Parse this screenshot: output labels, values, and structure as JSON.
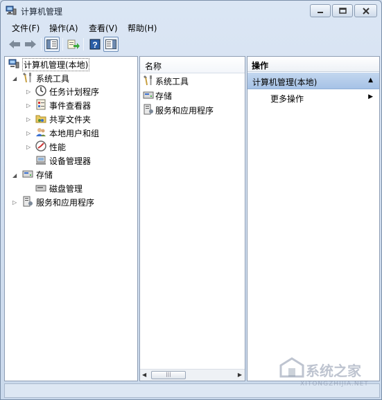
{
  "window": {
    "title": "计算机管理",
    "title_icon": "computer-management-icon"
  },
  "menu": [
    "文件(F)",
    "操作(A)",
    "查看(V)",
    "帮助(H)"
  ],
  "toolbar": {
    "buttons": [
      "back-arrow-icon",
      "forward-arrow-icon",
      "show-hide-console-tree-icon",
      "export-list-icon",
      "help-icon",
      "show-hide-action-pane-icon"
    ]
  },
  "tree": {
    "root": "计算机管理(本地)",
    "system_tools": "系统工具",
    "task_scheduler": "任务计划程序",
    "event_viewer": "事件查看器",
    "shared_folders": "共享文件夹",
    "local_users": "本地用户和组",
    "performance": "性能",
    "device_manager": "设备管理器",
    "storage": "存储",
    "disk_management": "磁盘管理",
    "services": "服务和应用程序"
  },
  "list": {
    "column": "名称",
    "items": [
      "系统工具",
      "存储",
      "服务和应用程序"
    ]
  },
  "actions": {
    "header": "操作",
    "section": "计算机管理(本地)",
    "more": "更多操作"
  },
  "watermark": {
    "brand": "系统之家",
    "url": "XITONGZHIJIA.NET"
  }
}
